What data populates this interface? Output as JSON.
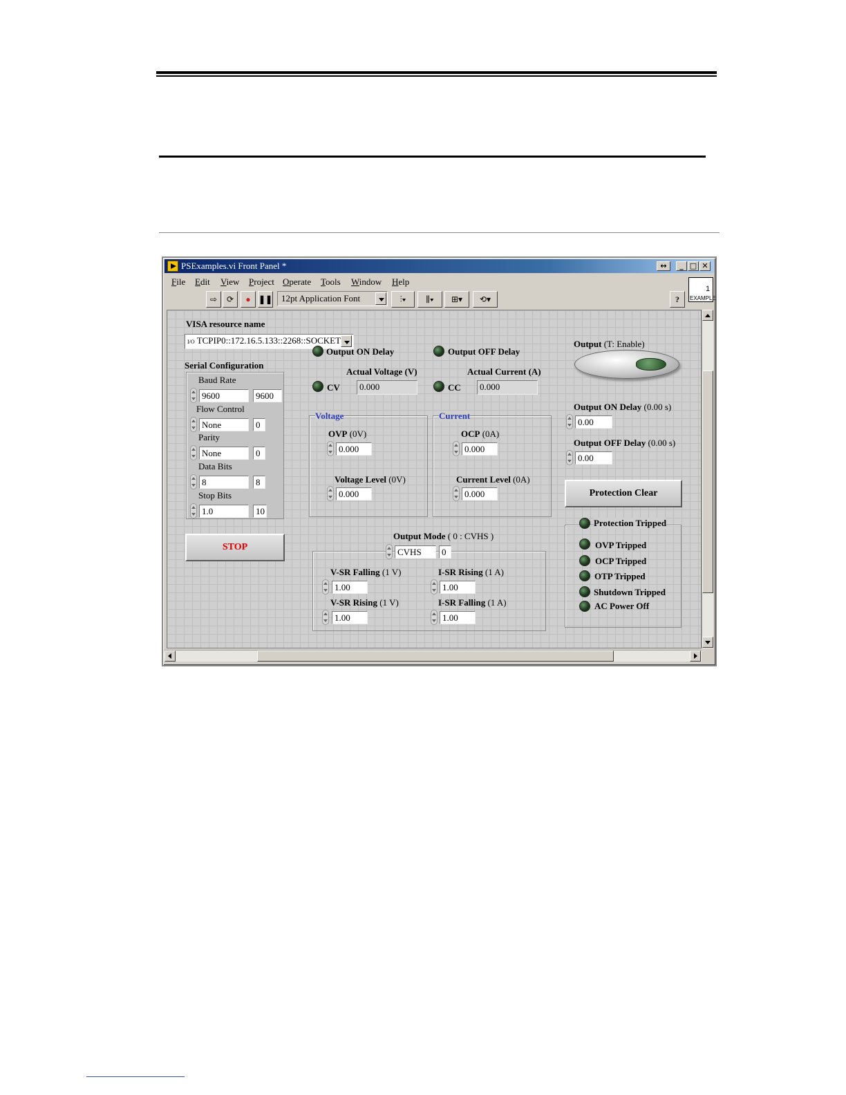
{
  "window": {
    "title": "PSExamples.vi Front Panel *",
    "menu": [
      "File",
      "Edit",
      "View",
      "Project",
      "Operate",
      "Tools",
      "Window",
      "Help"
    ],
    "font_selector": "12pt Application Font",
    "example_icon_label": "EXAMPLE",
    "example_icon_number": "1"
  },
  "panel": {
    "visa": {
      "label": "VISA resource name",
      "value": "TCPIP0::172.16.5.133::2268::SOCKET",
      "prefix": "I/O"
    },
    "serial": {
      "title": "Serial Configuration",
      "baud": {
        "label": "Baud Rate",
        "value": "9600",
        "indicator": "9600"
      },
      "flow": {
        "label": "Flow Control",
        "value": "None",
        "indicator": "0"
      },
      "parity": {
        "label": "Parity",
        "value": "None",
        "indicator": "0"
      },
      "data_bits": {
        "label": "Data Bits",
        "value": "8",
        "indicator": "8"
      },
      "stop_bits": {
        "label": "Stop Bits",
        "value": "1.0",
        "indicator": "10"
      }
    },
    "stop_label": "STOP",
    "output_on_delay_led": "Output ON Delay",
    "output_off_delay_led": "Output OFF Delay",
    "actual_voltage": {
      "label": "Actual Voltage (V)",
      "value": "0.000",
      "led": "CV"
    },
    "actual_current": {
      "label": "Actual Current (A)",
      "value": "0.000",
      "led": "CC"
    },
    "voltage_group": {
      "title": "Voltage",
      "ovp": {
        "label": "OVP",
        "unit": "(0V)",
        "value": "0.000"
      },
      "level": {
        "label": "Voltage Level",
        "unit": "(0V)",
        "value": "0.000"
      }
    },
    "current_group": {
      "title": "Current",
      "ocp": {
        "label": "OCP",
        "unit": "(0A)",
        "value": "0.000"
      },
      "level": {
        "label": "Current Level",
        "unit": "(0A)",
        "value": "0.000"
      }
    },
    "output_mode": {
      "label": "Output Mode",
      "unit": "( 0 : CVHS )",
      "value": "CVHS",
      "indicator": "0",
      "v_sr_falling": {
        "label": "V-SR Falling",
        "unit": "(1 V)",
        "value": "1.00"
      },
      "v_sr_rising": {
        "label": "V-SR Rising",
        "unit": "(1 V)",
        "value": "1.00"
      },
      "i_sr_rising": {
        "label": "I-SR Rising",
        "unit": "(1 A)",
        "value": "1.00"
      },
      "i_sr_falling": {
        "label": "I-SR Falling",
        "unit": "(1 A)",
        "value": "1.00"
      }
    },
    "output": {
      "label": "Output",
      "hint": "(T: Enable)"
    },
    "on_delay": {
      "label": "Output ON Delay",
      "unit": "(0.00 s)",
      "value": "0.00"
    },
    "off_delay": {
      "label": "Output OFF Delay",
      "unit": "(0.00 s)",
      "value": "0.00"
    },
    "protection_clear": "Protection Clear",
    "protection": {
      "title": "Protection Tripped",
      "items": [
        "OVP Tripped",
        "OCP Tripped",
        "OTP Tripped",
        "Shutdown Tripped",
        "AC Power Off"
      ]
    }
  },
  "colors": {
    "title_bar": "#0a246a",
    "panel_bg": "#cfcfcf",
    "stop_text": "#e00000",
    "group_title": "#2a3cb0",
    "led_off": "#1f3a1f"
  }
}
